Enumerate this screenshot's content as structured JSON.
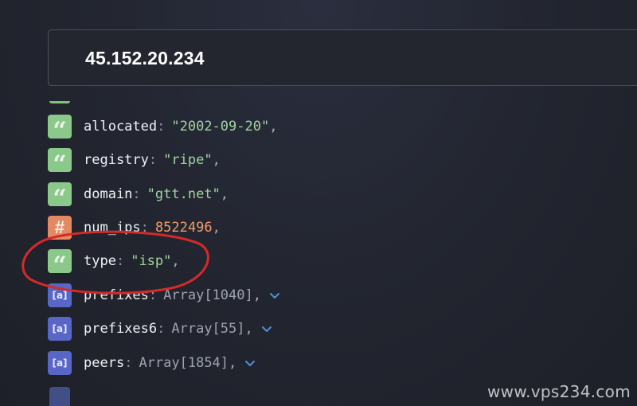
{
  "search": {
    "value": "45.152.20.234"
  },
  "fields": [
    {
      "key": "allocated",
      "value": "\"2002-09-20\"",
      "type": "string",
      "icon": "quote-icon"
    },
    {
      "key": "registry",
      "value": "\"ripe\"",
      "type": "string",
      "icon": "quote-icon"
    },
    {
      "key": "domain",
      "value": "\"gtt.net\"",
      "type": "string",
      "icon": "quote-icon"
    },
    {
      "key": "num_ips",
      "value": "8522496",
      "type": "number",
      "icon": "hash-icon"
    },
    {
      "key": "type",
      "value": "\"isp\"",
      "type": "string",
      "icon": "quote-icon"
    },
    {
      "key": "prefixes",
      "value": "Array[1040]",
      "type": "array",
      "icon": "array-icon"
    },
    {
      "key": "prefixes6",
      "value": "Array[55]",
      "type": "array",
      "icon": "array-icon"
    },
    {
      "key": "peers",
      "value": "Array[1854]",
      "type": "array",
      "icon": "array-icon"
    }
  ],
  "glyphs": {
    "quote": "“",
    "hash": "#",
    "array": "[a]",
    "colon": ":",
    "comma": ","
  },
  "watermark": "www.vps234.com",
  "colors": {
    "string_badge": "#8bc98a",
    "number_badge": "#e38a62",
    "array_badge": "#5866c6",
    "annotation": "#d42a2a"
  }
}
